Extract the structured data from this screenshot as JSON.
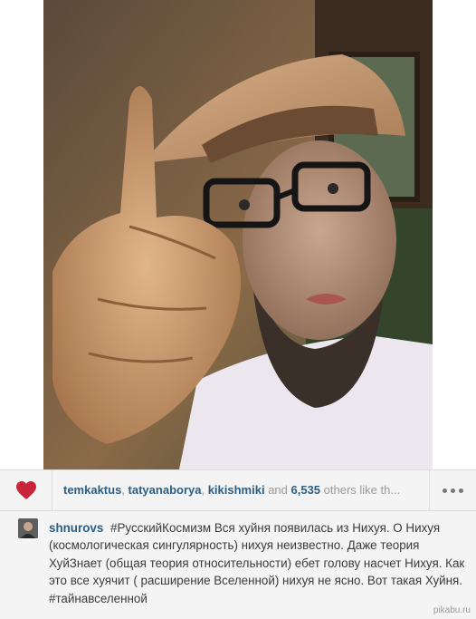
{
  "photo": {
    "subject": "photo-main"
  },
  "likes": {
    "users": [
      "temkaktus",
      "tatyanaborya",
      "kikishmiki"
    ],
    "separator": ", ",
    "and_text": " and ",
    "count": "6,535",
    "suffix": " others like th..."
  },
  "caption": {
    "author": "shnurovs",
    "text": "#РусскийКосмизм Вся хуйня появилась из Нихуя. О Нихуя (космологическая сингулярность) нихуя неизвестно. Даже теория ХуйЗнает (общая теория относительности) ебет голову насчет Нихуя. Как это все хуячит ( расширение Вселенной) нихуя не ясно. Вот такая Хуйня. #тайнавселенной"
  },
  "watermark": "pikabu.ru",
  "colors": {
    "heart": "#c8253a",
    "link": "#2d5d83",
    "text": "#3b3b3b"
  }
}
